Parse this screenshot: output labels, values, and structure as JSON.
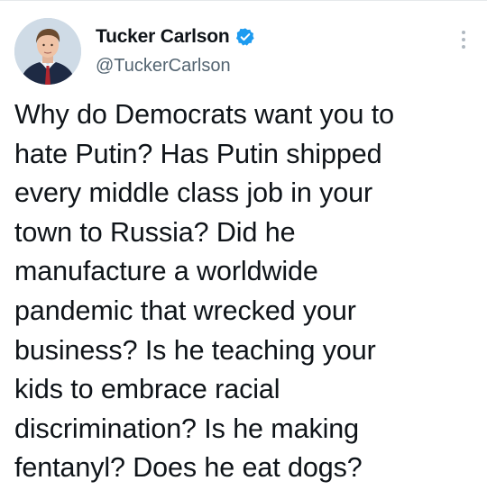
{
  "author": {
    "display_name": "Tucker Carlson",
    "handle": "@TuckerCarlson",
    "verified": true,
    "avatar_icon": "profile-photo"
  },
  "tweet": {
    "text": "Why do Democrats want you to\nhate Putin? Has Putin shipped\nevery middle class job in your\ntown to Russia? Did he\nmanufacture a worldwide\npandemic that wrecked your\nbusiness? Is he teaching your\nkids to embrace racial\ndiscrimination? Is he making\nfentanyl? Does he eat dogs?"
  },
  "menu": {
    "icon": "more-vertical-icon"
  },
  "colors": {
    "text": "#0f1419",
    "secondary": "#536471",
    "verified": "#1d9bf0",
    "background": "#ffffff"
  }
}
